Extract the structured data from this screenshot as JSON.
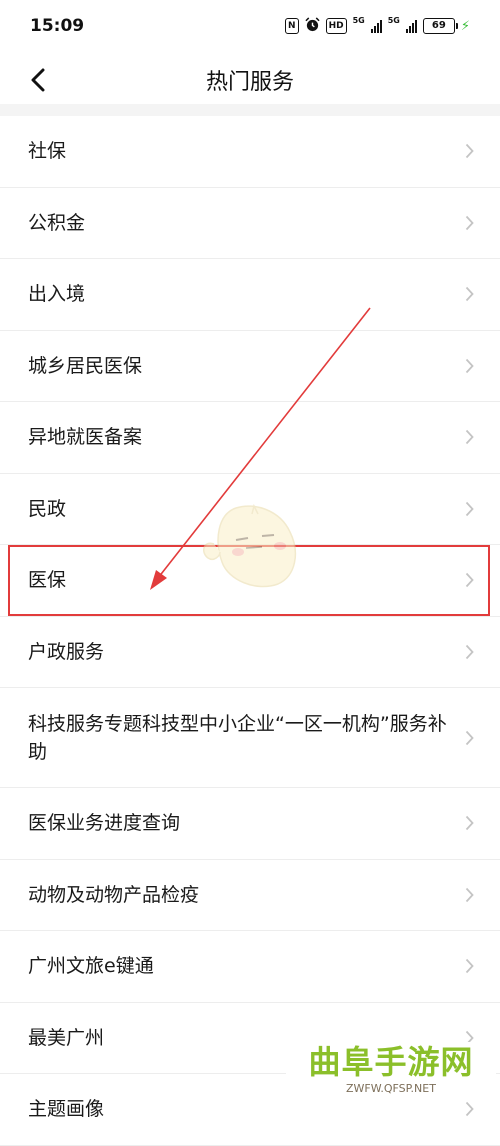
{
  "status_bar": {
    "time": "15:09",
    "nfc_icon": "N",
    "hd_icon": "HD",
    "net1": "5G",
    "net2": "5G",
    "battery": "69"
  },
  "nav": {
    "title": "热门服务",
    "back_icon": "chevron-left-icon"
  },
  "items": [
    {
      "label": "社保"
    },
    {
      "label": "公积金"
    },
    {
      "label": "出入境"
    },
    {
      "label": "城乡居民医保"
    },
    {
      "label": "异地就医备案"
    },
    {
      "label": "民政"
    },
    {
      "label": "医保"
    },
    {
      "label": "户政服务"
    },
    {
      "label": "科技服务专题科技型中小企业“一区一机构”服务补助"
    },
    {
      "label": "医保业务进度查询"
    },
    {
      "label": "动物及动物产品检疫"
    },
    {
      "label": "广州文旅e键通"
    },
    {
      "label": "最美广州"
    },
    {
      "label": "主题画像"
    }
  ],
  "annotation": {
    "highlight_color": "#e23b3b"
  },
  "watermark": {
    "main": "曲阜手游网",
    "sub": "ZWFW.QFSP.NET"
  }
}
